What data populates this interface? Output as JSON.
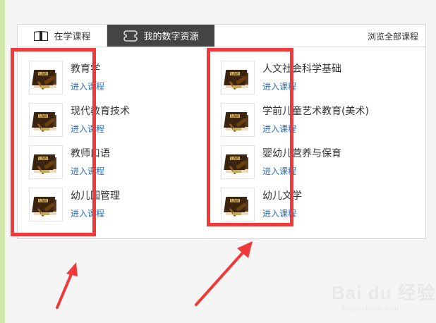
{
  "tabs": {
    "active_label": "在学课程",
    "resources_label": "我的数字资源",
    "browse_all": "浏览全部课程"
  },
  "courses_left": [
    {
      "title": "教育学",
      "enter": "进入课程"
    },
    {
      "title": "现代教育技术",
      "enter": "进入课程"
    },
    {
      "title": "教师口语",
      "enter": "进入课程"
    },
    {
      "title": "幼儿园管理",
      "enter": "进入课程"
    }
  ],
  "courses_right": [
    {
      "title": "人文社会科学基础",
      "enter": "进入课程"
    },
    {
      "title": "学前儿童艺术教育(美术)",
      "enter": "进入课程"
    },
    {
      "title": "婴幼儿营养与保育",
      "enter": "进入课程"
    },
    {
      "title": "幼儿文学",
      "enter": "进入课程"
    }
  ],
  "icons": {
    "book": "book-icon",
    "resource": "resource-icon",
    "course_thumb": "law-book-gavel-icon"
  },
  "annotation_color": "#f03a3a",
  "watermark": {
    "main": "Bai du 经验",
    "sub": "jingyan.baidu.com"
  }
}
